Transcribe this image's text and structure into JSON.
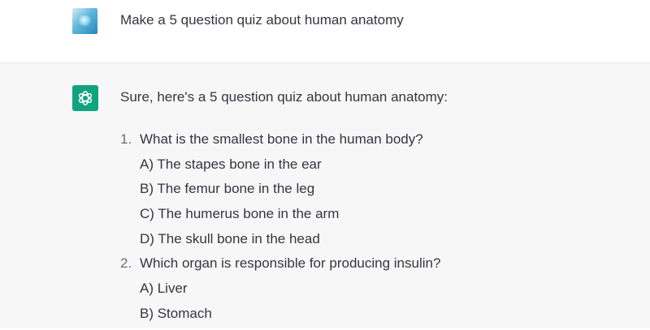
{
  "user_message": {
    "avatar_icon": "user-avatar-image",
    "text": "Make a 5 question quiz about human anatomy"
  },
  "assistant_message": {
    "avatar_icon": "openai-logo-icon",
    "avatar_color": "#10a37f",
    "intro": "Sure, here's a 5 question quiz about human anatomy:",
    "questions": [
      {
        "number": "1.",
        "text": "What is the smallest bone in the human body?",
        "options": [
          "A) The stapes bone in the ear",
          "B) The femur bone in the leg",
          "C) The humerus bone in the arm",
          "D) The skull bone in the head"
        ]
      },
      {
        "number": "2.",
        "text": "Which organ is responsible for producing insulin?",
        "options": [
          "A) Liver",
          "B) Stomach"
        ]
      }
    ]
  }
}
